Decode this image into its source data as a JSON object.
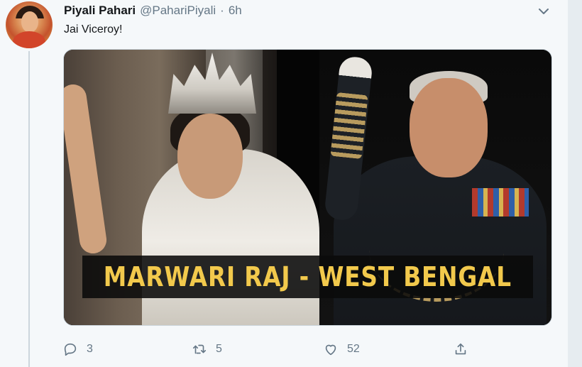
{
  "tweet": {
    "author_name": "Piyali Pahari",
    "handle": "@PahariPiyali",
    "separator": "·",
    "time": "6h",
    "text": "Jai Viceroy!"
  },
  "media": {
    "banner_text": "MARWARI RAJ - WEST BENGAL",
    "banner_color": "#f2c94c"
  },
  "actions": {
    "reply_count": "3",
    "retweet_count": "5",
    "like_count": "52"
  },
  "icons": [
    "caret-down-icon",
    "reply-icon",
    "retweet-icon",
    "like-icon",
    "share-icon"
  ]
}
